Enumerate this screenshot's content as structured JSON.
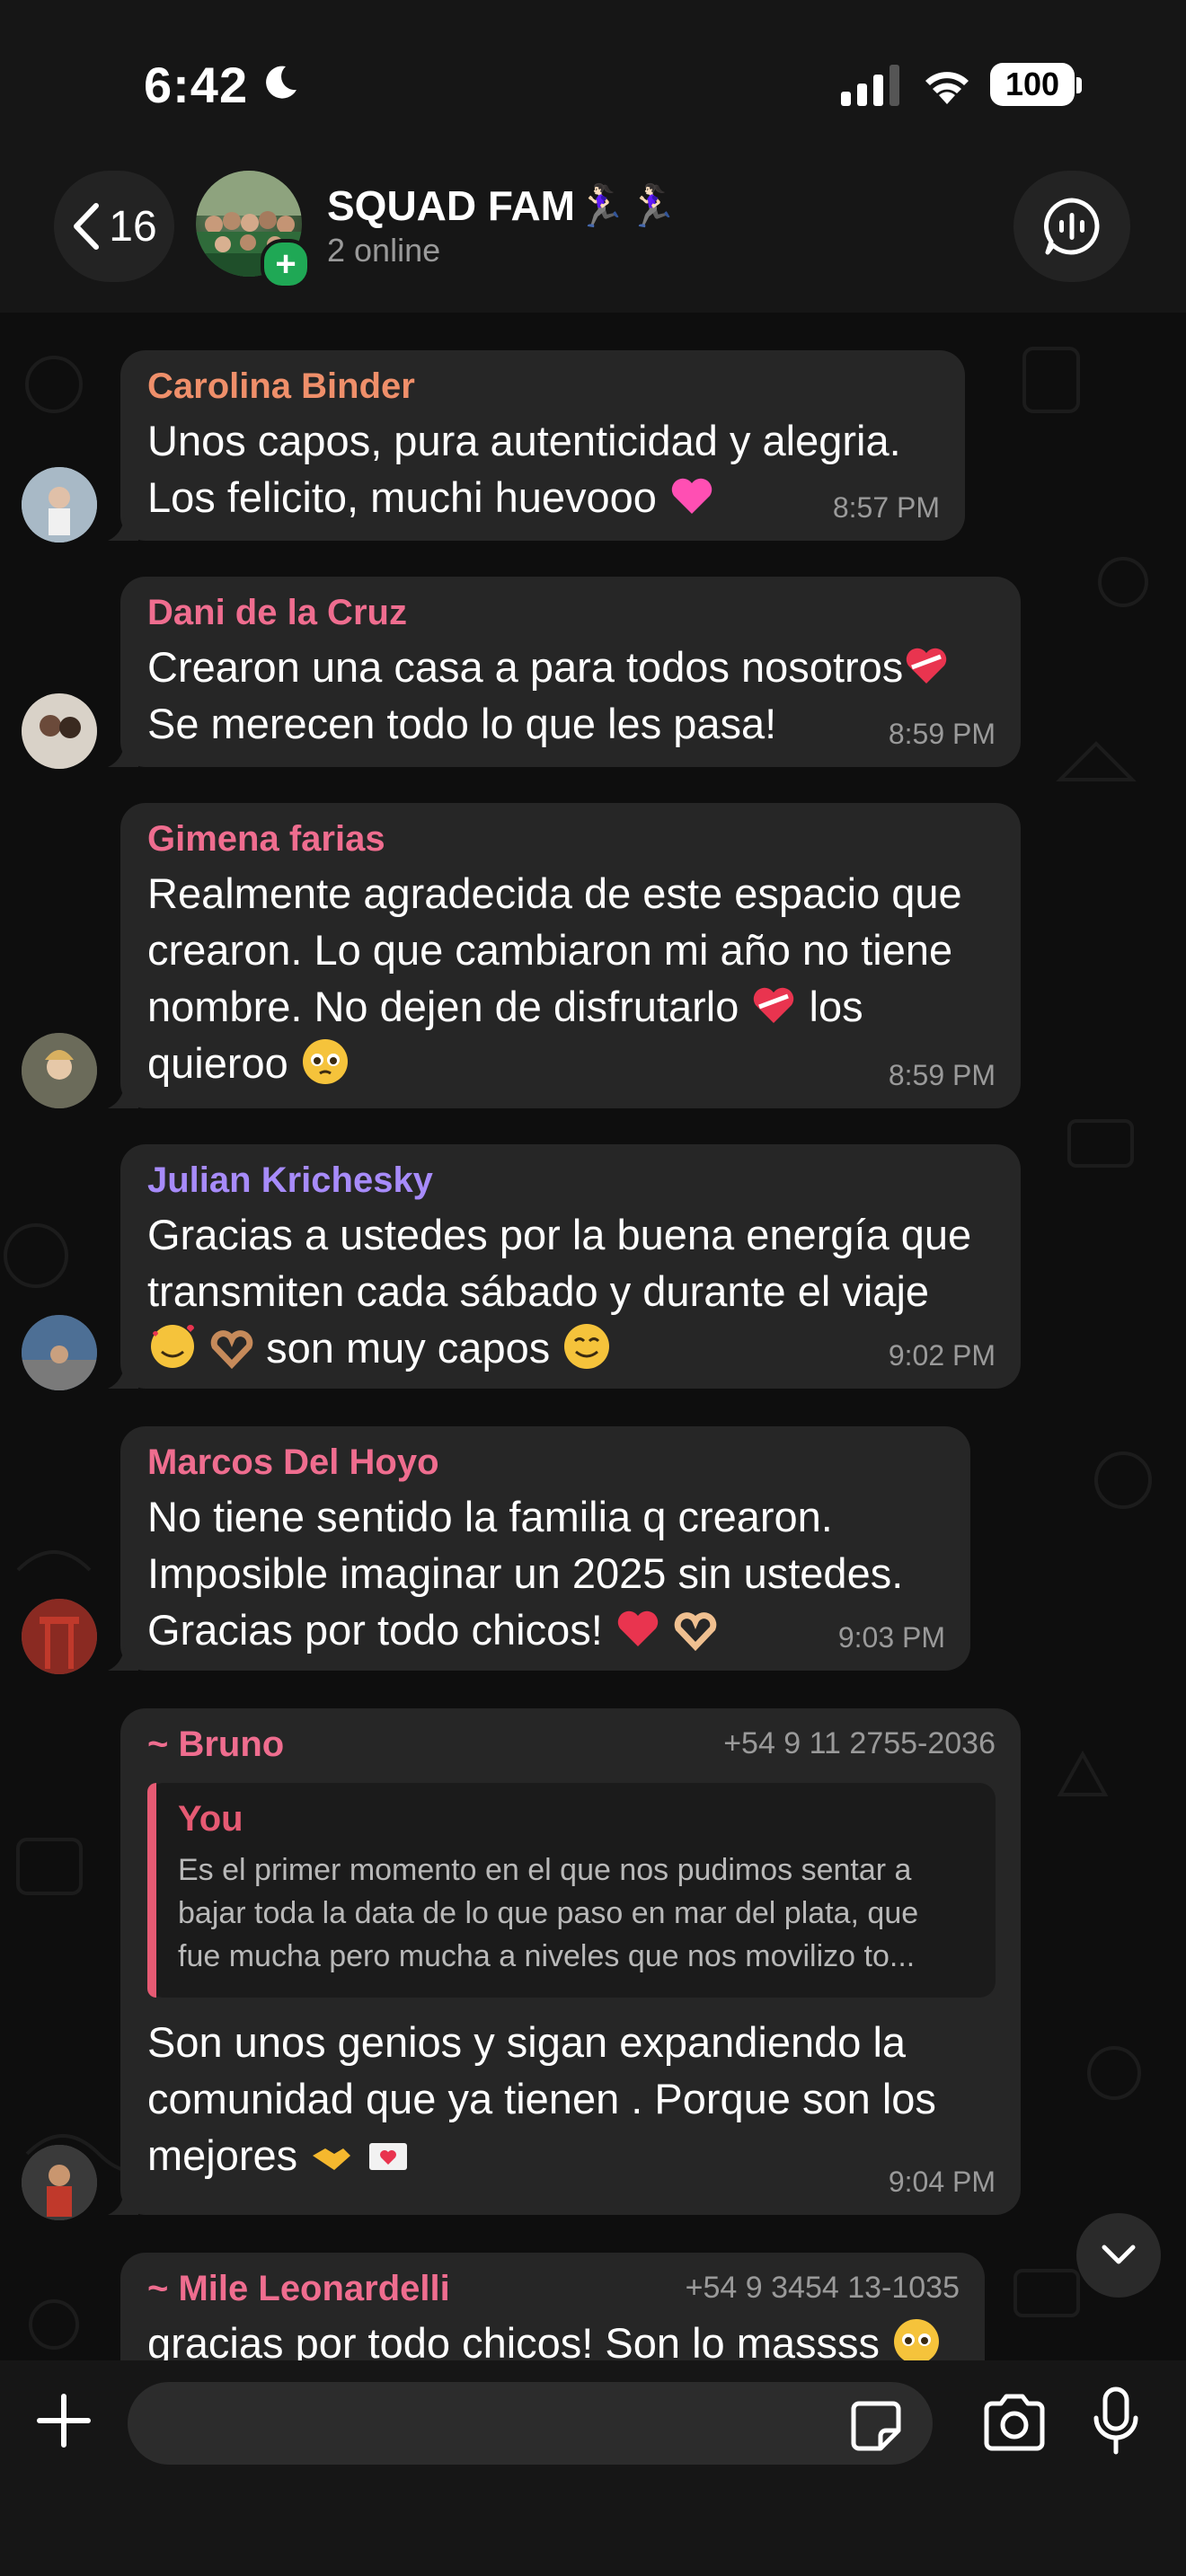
{
  "status": {
    "time": "6:42",
    "battery": "100"
  },
  "header": {
    "back_count": "16",
    "title": "SQUAD FAM🏃🏻‍♀️🏃🏻‍♀️",
    "subtitle": "2 online"
  },
  "messages": [
    {
      "sender": "Carolina Binder",
      "color": "#ef8f6a",
      "lines": [
        "Unos capos, pura autenticidad y alegria.",
        "Los felicito, muchi huevooo"
      ],
      "time": "8:57 PM"
    },
    {
      "sender": "Dani de la Cruz",
      "color": "#ef6d8f",
      "lines": [
        "Crearon una casa a para todos nosotros",
        "Se merecen todo lo que les pasa!"
      ],
      "time": "8:59 PM"
    },
    {
      "sender": "Gimena farias",
      "color": "#ef6d8f",
      "lines": [
        "Realmente agradecida de este espacio que",
        "crearon. Lo que cambiaron mi año no tiene",
        "nombre. No dejen de disfrutarlo",
        "los",
        "quieroo"
      ],
      "time": "8:59 PM"
    },
    {
      "sender": "Julian Krichesky",
      "color": "#a78bfa",
      "lines": [
        "Gracias a ustedes por la buena energía que",
        "transmiten cada sábado y durante el viaje",
        "son muy capos"
      ],
      "time": "9:02 PM"
    },
    {
      "sender": "Marcos Del Hoyo",
      "color": "#ef6d8f",
      "lines": [
        "No tiene sentido la familia q crearon.",
        "Imposible imaginar un 2025 sin ustedes.",
        "Gracias por todo chicos!"
      ],
      "time": "9:03 PM"
    },
    {
      "sender": "~ Bruno",
      "color": "#ef6d8f",
      "phone": "+54 9 11 2755-2036",
      "quote_name": "You",
      "quote_lines": [
        "Es el primer momento en el que nos pudimos sentar a",
        "bajar toda la data de lo que paso en mar del plata, que",
        "fue mucha pero mucha a niveles que nos movilizo to..."
      ],
      "lines": [
        "Son unos genios y sigan expandiendo  la",
        "comunidad que ya tienen . Porque son los",
        "mejores"
      ],
      "time": "9:04 PM"
    },
    {
      "sender": "~ Mile Leonardelli",
      "color": "#ef6d8f",
      "phone": "+54 9 3454 13-1035",
      "lines": [
        "gracias por todo chicos! Son lo massss"
      ]
    }
  ]
}
